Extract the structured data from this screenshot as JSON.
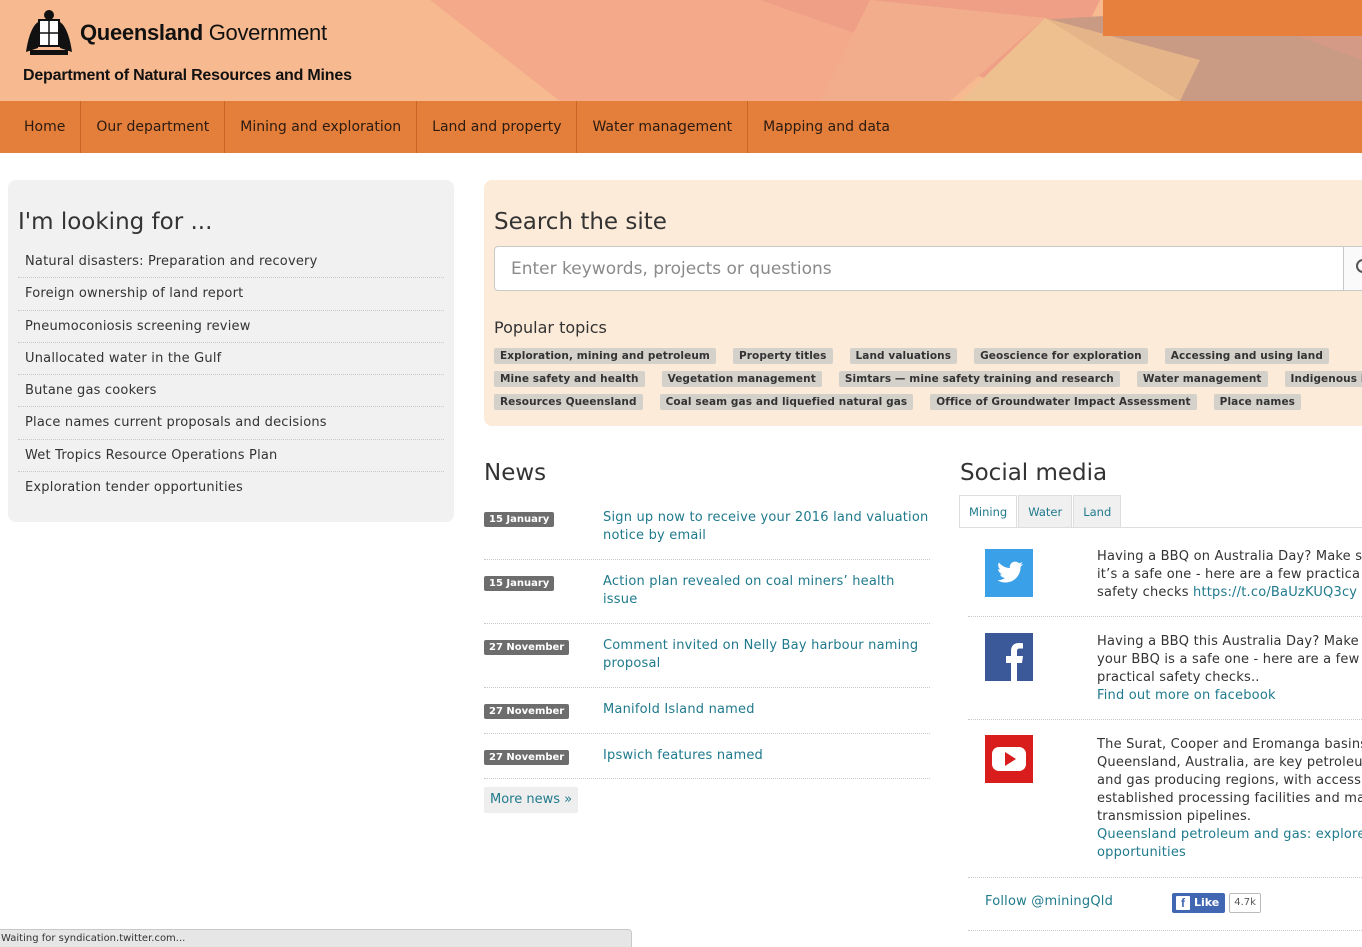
{
  "header": {
    "brand_bold": "Queensland",
    "brand_light": " Government",
    "department": "Department of Natural Resources and Mines",
    "accent_color": "#e47e3b"
  },
  "nav": {
    "items": [
      "Home",
      "Our department",
      "Mining and exploration",
      "Land and property",
      "Water management",
      "Mapping and data"
    ]
  },
  "looking": {
    "title": "I'm looking for ...",
    "items": [
      "Natural disasters: Preparation and recovery",
      "Foreign ownership of land report",
      "Pneumoconiosis screening review",
      "Unallocated water in the Gulf",
      "Butane gas cookers",
      "Place names current proposals and decisions",
      "Wet Tropics Resource Operations Plan",
      "Exploration tender opportunities"
    ]
  },
  "search": {
    "title": "Search the site",
    "placeholder": "Enter keywords, projects or questions",
    "popular_title": "Popular topics",
    "tag_rows": [
      [
        "Exploration, mining and petroleum",
        "Property titles",
        "Land valuations",
        "Geoscience for exploration",
        "Accessing and using land"
      ],
      [
        "Mine safety and health",
        "Vegetation management",
        "Simtars — mine safety training and research",
        "Water management",
        "Indigenous interests"
      ],
      [
        "Resources Queensland",
        "Coal seam gas and liquefied natural gas",
        "Office of Groundwater Impact Assessment",
        "Place names"
      ]
    ]
  },
  "news": {
    "title": "News",
    "items": [
      {
        "date": "15 January",
        "line1": "Sign up now to receive your 2016 land valuation",
        "line2": "notice by email"
      },
      {
        "date": "15 January",
        "line1": "Action plan revealed on coal miners’ health",
        "line2": "issue"
      },
      {
        "date": "27 November",
        "line1": "Comment invited on Nelly Bay harbour naming",
        "line2": "proposal"
      },
      {
        "date": "27 November",
        "line1": "Manifold Island named",
        "line2": ""
      },
      {
        "date": "27 November",
        "line1": "Ipswich features named",
        "line2": ""
      }
    ],
    "more": "More news »"
  },
  "social": {
    "title": "Social media",
    "tabs": [
      "Mining",
      "Water",
      "Land"
    ],
    "items": [
      {
        "icon": "twitter-icon",
        "lines": [
          "Having a BBQ on Australia Day? Make s",
          "it’s a safe one - here are a few practica",
          "safety checks "
        ],
        "link": "https://t.co/BaUzKUQ3cy"
      },
      {
        "icon": "facebook-icon",
        "lines": [
          "Having a BBQ this Australia Day? Make",
          "your BBQ is a safe one - here are a few",
          "practical safety checks.."
        ],
        "link": "Find out more on facebook"
      },
      {
        "icon": "youtube-icon",
        "lines": [
          "The Surat, Cooper and Eromanga basins",
          "Queensland, Australia, are key petroleu",
          "and gas producing regions, with access",
          "established processing facilities and ma",
          "transmission pipelines."
        ],
        "link_lines": [
          "Queensland petroleum and gas: explore",
          "opportunities"
        ]
      }
    ],
    "follow": "Follow @miningQld",
    "like_label": "Like",
    "like_count": "4.7k"
  },
  "status_bar": "Waiting for syndication.twitter.com..."
}
